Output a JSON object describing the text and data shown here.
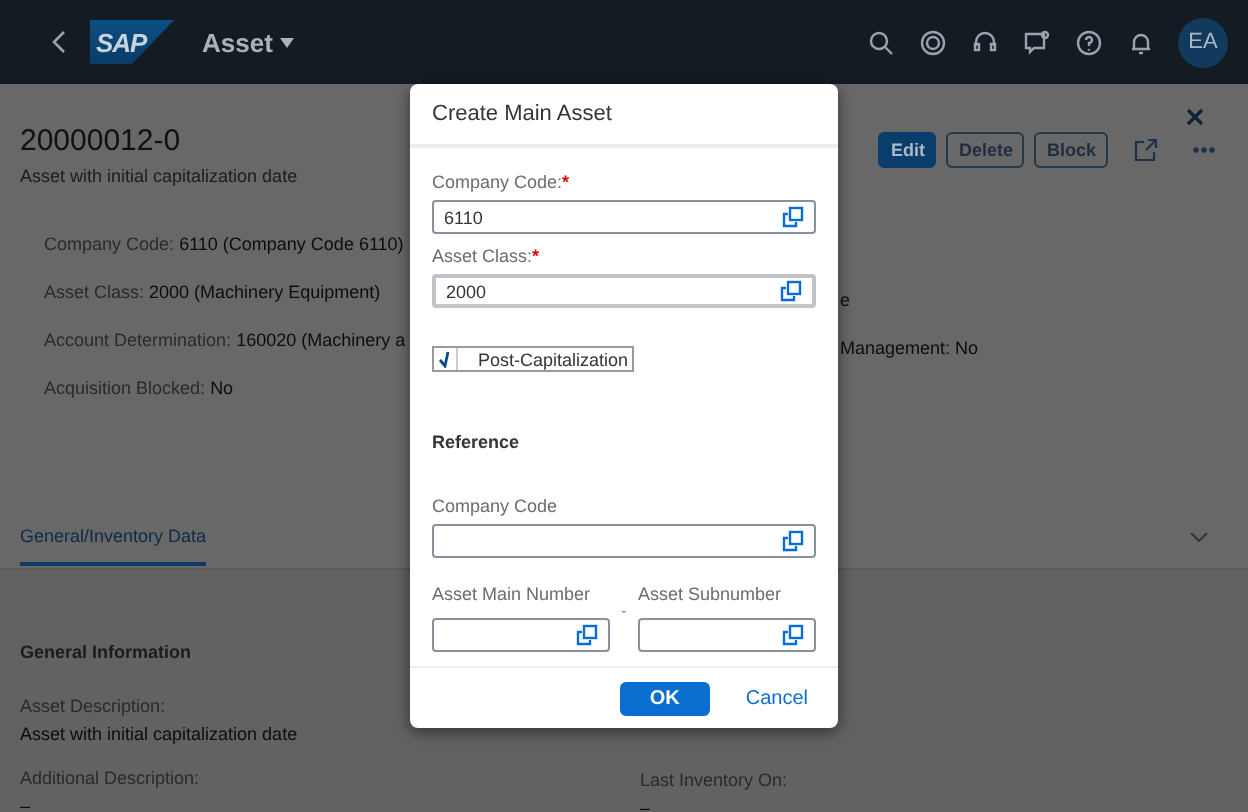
{
  "shell": {
    "logo_text": "SAP",
    "title": "Asset",
    "avatar": "EA"
  },
  "object": {
    "title": "20000012-0",
    "subtitle": "Asset with initial capitalization date",
    "actions": [
      {
        "label": "Edit",
        "kind": "primary"
      },
      {
        "label": "Delete",
        "kind": "outline"
      },
      {
        "label": "Block",
        "kind": "outline"
      }
    ]
  },
  "header_fields": [
    {
      "label": "Company Code:",
      "value": "6110 (Company Code 6110)"
    },
    {
      "label": "Asset Class:",
      "value": "2000 (Machinery Equipment)"
    },
    {
      "label": "Account Determination:",
      "value": "160020 (Machinery a"
    },
    {
      "label": "Acquisition Blocked:",
      "value": "No"
    }
  ],
  "header_fields_right": [
    {
      "text": "e"
    },
    {
      "text": "Management: No"
    }
  ],
  "tabs": [
    {
      "label": "General/Inventory Data",
      "selected": true
    }
  ],
  "section": {
    "title": "General Information",
    "left": [
      {
        "label": "Asset Description:",
        "value": "Asset with initial capitalization date"
      },
      {
        "label": "Additional Description:",
        "value": "–"
      }
    ],
    "right": [
      {
        "label": "Last Inventory On:",
        "value": "–"
      }
    ]
  },
  "dialog": {
    "title": "Create Main Asset",
    "required_mark": "*",
    "items": [
      {
        "kind": "input",
        "label": "Company Code:",
        "required": true,
        "focused": false,
        "value": "6110"
      },
      {
        "kind": "input",
        "label": "Asset Class:",
        "required": true,
        "focused": true,
        "value": "2000"
      },
      {
        "kind": "checkbox",
        "label": "Post-Capitalization",
        "checked": true
      },
      {
        "kind": "heading",
        "label": "Reference"
      },
      {
        "kind": "input",
        "label": "Company Code",
        "required": false,
        "focused": false
      },
      {
        "kind": "pair",
        "separator": "-",
        "fields": [
          {
            "label": "Asset Main Number"
          },
          {
            "label": "Asset Subnumber"
          }
        ]
      }
    ],
    "buttons": [
      {
        "label": "OK",
        "kind": "emphasized"
      },
      {
        "label": "Cancel",
        "kind": "transparent"
      }
    ]
  }
}
